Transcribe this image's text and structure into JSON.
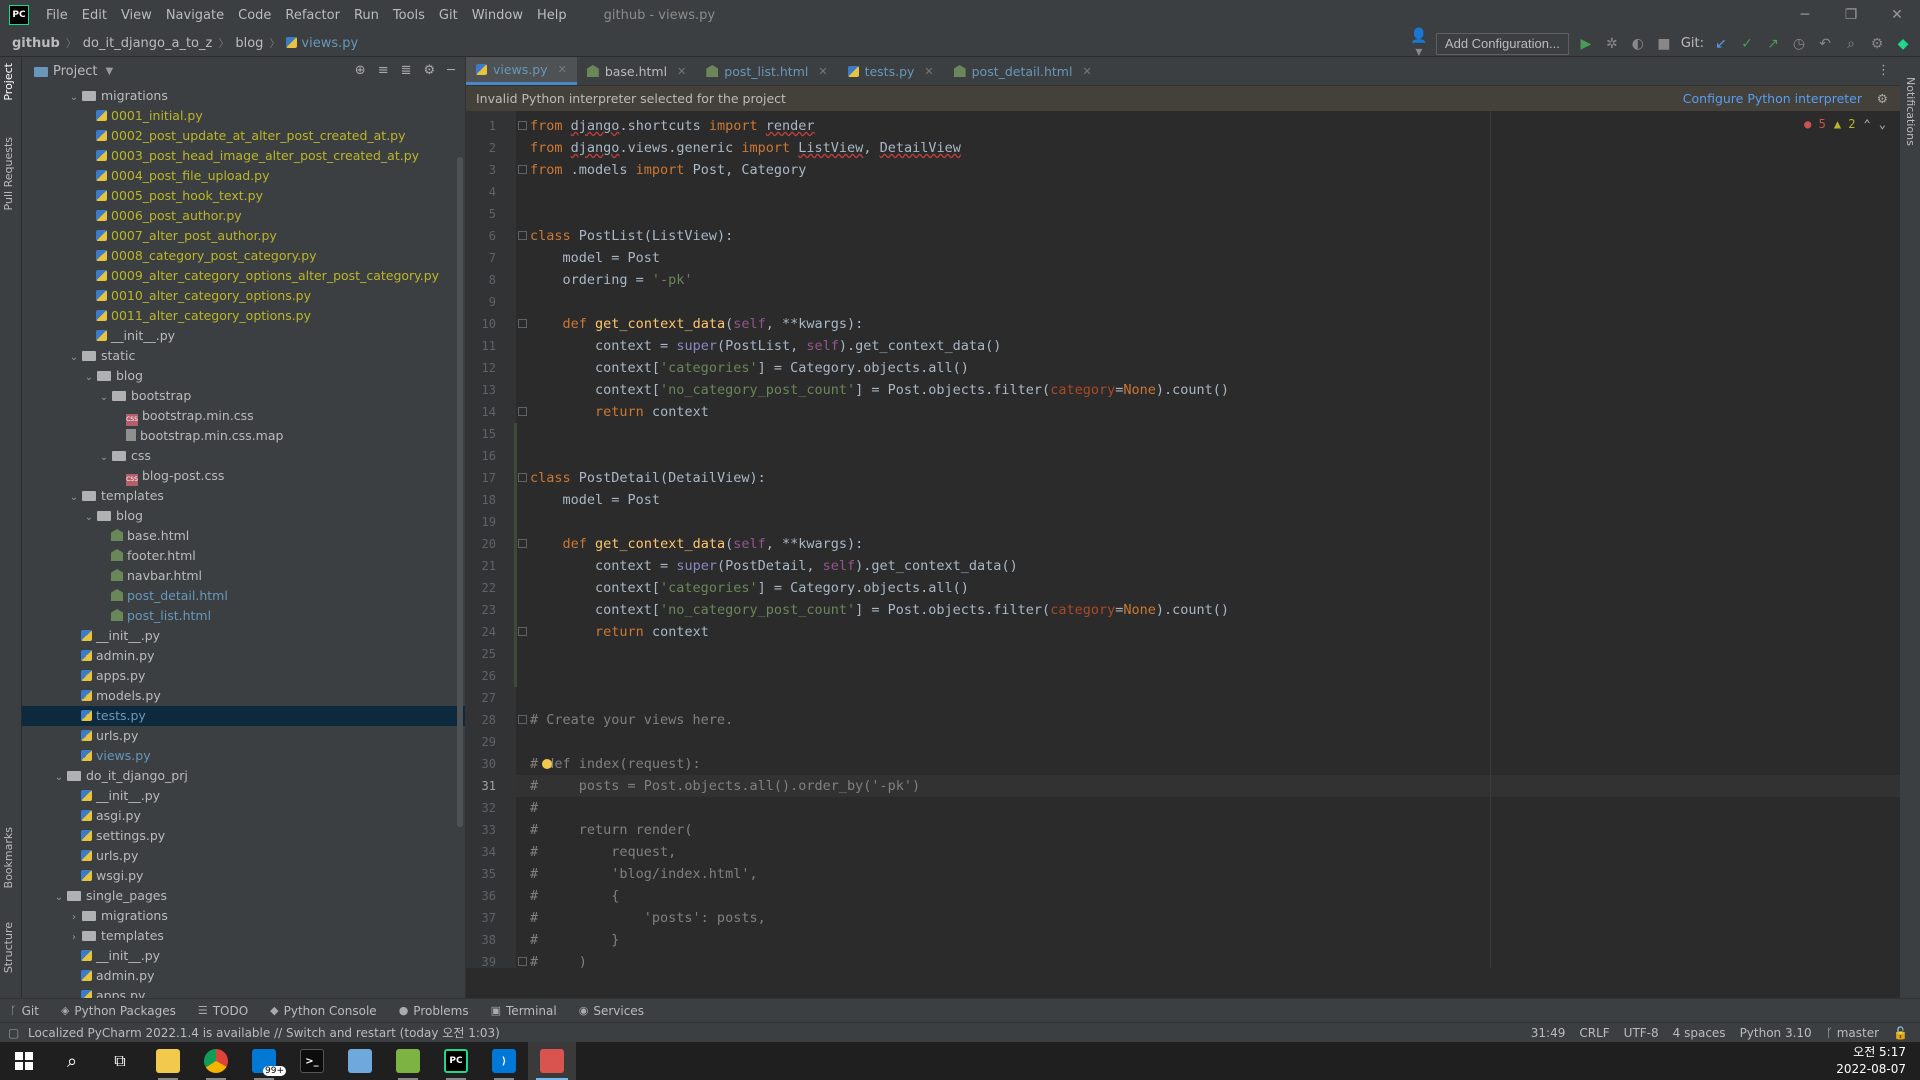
{
  "window": {
    "title": "github - views.py",
    "menu": [
      "File",
      "Edit",
      "View",
      "Navigate",
      "Code",
      "Refactor",
      "Run",
      "Tools",
      "Git",
      "Window",
      "Help"
    ]
  },
  "breadcrumb": [
    "github",
    "do_it_django_a_to_z",
    "blog",
    "views.py"
  ],
  "navbar": {
    "add_config": "Add Configuration...",
    "git_label": "Git:"
  },
  "project": {
    "title": "Project",
    "tree": [
      {
        "label": "migrations",
        "type": "folder",
        "depth": 2,
        "open": true
      },
      {
        "label": "0001_initial.py",
        "type": "py",
        "depth": 4,
        "color": "yellow"
      },
      {
        "label": "0002_post_update_at_alter_post_created_at.py",
        "type": "py",
        "depth": 4,
        "color": "yellow"
      },
      {
        "label": "0003_post_head_image_alter_post_created_at.py",
        "type": "py",
        "depth": 4,
        "color": "yellow"
      },
      {
        "label": "0004_post_file_upload.py",
        "type": "py",
        "depth": 4,
        "color": "yellow"
      },
      {
        "label": "0005_post_hook_text.py",
        "type": "py",
        "depth": 4,
        "color": "yellow"
      },
      {
        "label": "0006_post_author.py",
        "type": "py",
        "depth": 4,
        "color": "yellow"
      },
      {
        "label": "0007_alter_post_author.py",
        "type": "py",
        "depth": 4,
        "color": "yellow"
      },
      {
        "label": "0008_category_post_category.py",
        "type": "py",
        "depth": 4,
        "color": "yellow"
      },
      {
        "label": "0009_alter_category_options_alter_post_category.py",
        "type": "py",
        "depth": 4,
        "color": "yellow"
      },
      {
        "label": "0010_alter_category_options.py",
        "type": "py",
        "depth": 4,
        "color": "yellow"
      },
      {
        "label": "0011_alter_category_options.py",
        "type": "py",
        "depth": 4,
        "color": "yellow"
      },
      {
        "label": "__init__.py",
        "type": "py",
        "depth": 4,
        "color": "default"
      },
      {
        "label": "static",
        "type": "folder",
        "depth": 2,
        "open": true
      },
      {
        "label": "blog",
        "type": "folder",
        "depth": 3,
        "open": true
      },
      {
        "label": "bootstrap",
        "type": "folder",
        "depth": 4,
        "open": true
      },
      {
        "label": "bootstrap.min.css",
        "type": "css",
        "depth": 6,
        "color": "default"
      },
      {
        "label": "bootstrap.min.css.map",
        "type": "map",
        "depth": 6,
        "color": "default"
      },
      {
        "label": "css",
        "type": "folder",
        "depth": 4,
        "open": true
      },
      {
        "label": "blog-post.css",
        "type": "css",
        "depth": 6,
        "color": "default"
      },
      {
        "label": "templates",
        "type": "folder",
        "depth": 2,
        "open": true
      },
      {
        "label": "blog",
        "type": "folder",
        "depth": 3,
        "open": true
      },
      {
        "label": "base.html",
        "type": "html",
        "depth": 5,
        "color": "default"
      },
      {
        "label": "footer.html",
        "type": "html",
        "depth": 5,
        "color": "default"
      },
      {
        "label": "navbar.html",
        "type": "html",
        "depth": 5,
        "color": "default"
      },
      {
        "label": "post_detail.html",
        "type": "html",
        "depth": 5,
        "color": "blue"
      },
      {
        "label": "post_list.html",
        "type": "html",
        "depth": 5,
        "color": "blue"
      },
      {
        "label": "__init__.py",
        "type": "py",
        "depth": 3,
        "color": "default"
      },
      {
        "label": "admin.py",
        "type": "py",
        "depth": 3,
        "color": "default"
      },
      {
        "label": "apps.py",
        "type": "py",
        "depth": 3,
        "color": "default"
      },
      {
        "label": "models.py",
        "type": "py",
        "depth": 3,
        "color": "default"
      },
      {
        "label": "tests.py",
        "type": "py",
        "depth": 3,
        "color": "blue",
        "selected": true
      },
      {
        "label": "urls.py",
        "type": "py",
        "depth": 3,
        "color": "default"
      },
      {
        "label": "views.py",
        "type": "py",
        "depth": 3,
        "color": "blue"
      },
      {
        "label": "do_it_django_prj",
        "type": "folder",
        "depth": 1,
        "open": true
      },
      {
        "label": "__init__.py",
        "type": "py",
        "depth": 3,
        "color": "default"
      },
      {
        "label": "asgi.py",
        "type": "py",
        "depth": 3,
        "color": "default"
      },
      {
        "label": "settings.py",
        "type": "py",
        "depth": 3,
        "color": "default"
      },
      {
        "label": "urls.py",
        "type": "py",
        "depth": 3,
        "color": "default"
      },
      {
        "label": "wsgi.py",
        "type": "py",
        "depth": 3,
        "color": "default"
      },
      {
        "label": "single_pages",
        "type": "folder",
        "depth": 1,
        "open": true
      },
      {
        "label": "migrations",
        "type": "folder",
        "depth": 2,
        "open": false
      },
      {
        "label": "templates",
        "type": "folder",
        "depth": 2,
        "open": false
      },
      {
        "label": "__init__.py",
        "type": "py",
        "depth": 3,
        "color": "default"
      },
      {
        "label": "admin.py",
        "type": "py",
        "depth": 3,
        "color": "default"
      },
      {
        "label": "apps.py",
        "type": "py",
        "depth": 3,
        "color": "default"
      }
    ]
  },
  "tabs": [
    {
      "label": "views.py",
      "type": "py",
      "active": true,
      "color": "blue"
    },
    {
      "label": "base.html",
      "type": "html",
      "active": false,
      "color": "default"
    },
    {
      "label": "post_list.html",
      "type": "html",
      "active": false,
      "color": "blue"
    },
    {
      "label": "tests.py",
      "type": "py",
      "active": false,
      "color": "blue"
    },
    {
      "label": "post_detail.html",
      "type": "html",
      "active": false,
      "color": "blue"
    }
  ],
  "banner": {
    "message": "Invalid Python interpreter selected for the project",
    "link": "Configure Python interpreter"
  },
  "inspections": {
    "errors": "5",
    "warnings": "2"
  },
  "code": {
    "current_line": 31,
    "lines": [
      "<span class=\"kw\">from</span> <span class=\"wavy\">django</span>.shortcuts <span class=\"kw\">import</span> <span class=\"wavy\">render</span>",
      "<span class=\"kw\">from</span> <span class=\"wavy\">django</span>.views.generic <span class=\"kw\">import</span> <span class=\"wavy\">ListView</span>, <span class=\"wavy\">DetailView</span>",
      "<span class=\"kw\">from</span> .models <span class=\"kw\">import</span> Post, Category",
      "",
      "",
      "<span class=\"kw\">class</span> PostList(ListView):",
      "    model = Post",
      "    ordering = <span class=\"str\">'-pk'</span>",
      "",
      "    <span class=\"kw\">def</span> <span class=\"fn\">get_context_data</span>(<span class=\"slf\">self</span>, **kwargs):",
      "        context = <span class=\"bi\">super</span>(PostList, <span class=\"slf\">self</span>).get_context_data()",
      "        context[<span class=\"str\">'categories'</span>] = Category.objects.all()",
      "        context[<span class=\"str\">'no_category_post_count'</span>] = Post.objects.filter(<span class=\"prm\">category</span>=<span class=\"kw\">None</span>).count()",
      "        <span class=\"kw\">return</span> context",
      "",
      "",
      "<span class=\"kw\">class</span> PostDetail(DetailView):",
      "    model = Post",
      "",
      "    <span class=\"kw\">def</span> <span class=\"fn\">get_context_data</span>(<span class=\"slf\">self</span>, **kwargs):",
      "        context = <span class=\"bi\">super</span>(PostDetail, <span class=\"slf\">self</span>).get_context_data()",
      "        context[<span class=\"str\">'categories'</span>] = Category.objects.all()",
      "        context[<span class=\"str\">'no_category_post_count'</span>] = Post.objects.filter(<span class=\"prm\">category</span>=<span class=\"kw\">None</span>).count()",
      "        <span class=\"kw\">return</span> context",
      "",
      "",
      "",
      "<span class=\"cmt\"># Create your views here.</span>",
      "",
      "<span class=\"cmt\"># def index(request):</span>",
      "<span class=\"cmt\">#     posts = Post.objects.all().order_by('-pk')</span>",
      "<span class=\"cmt\">#</span>",
      "<span class=\"cmt\">#     return render(</span>",
      "<span class=\"cmt\">#         request,</span>",
      "<span class=\"cmt\">#         'blog/index.html',</span>",
      "<span class=\"cmt\">#         {</span>",
      "<span class=\"cmt\">#             'posts': posts,</span>",
      "<span class=\"cmt\">#         }</span>",
      "<span class=\"cmt\">#     )</span>"
    ]
  },
  "toolwindows": [
    {
      "label": "Git",
      "icon": "branch-icon"
    },
    {
      "label": "Python Packages",
      "icon": "package-icon"
    },
    {
      "label": "TODO",
      "icon": "list-icon"
    },
    {
      "label": "Python Console",
      "icon": "python-icon"
    },
    {
      "label": "Problems",
      "icon": "warning-icon"
    },
    {
      "label": "Terminal",
      "icon": "terminal-icon"
    },
    {
      "label": "Services",
      "icon": "services-icon"
    }
  ],
  "status": {
    "message": "Localized PyCharm 2022.1.4 is available // Switch and restart (today 오전 1:03)",
    "position": "31:49",
    "line_sep": "CRLF",
    "encoding": "UTF-8",
    "indent": "4 spaces",
    "interpreter": "Python 3.10",
    "branch": "master"
  },
  "left_strip": [
    "Project",
    "Pull Requests",
    "Bookmarks",
    "Structure"
  ],
  "right_strip": [
    "Notifications"
  ],
  "taskbar": {
    "clock_time": "오전 5:17",
    "clock_date": "2022-08-07",
    "badge": "99+"
  }
}
